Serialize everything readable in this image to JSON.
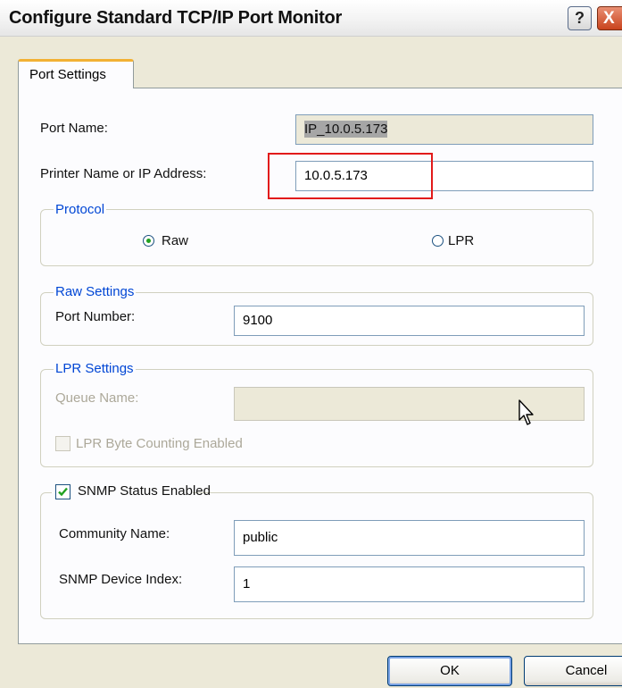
{
  "window": {
    "title": "Configure Standard TCP/IP Port Monitor",
    "help_glyph": "?",
    "close_glyph": "X"
  },
  "tabs": [
    {
      "label": "Port Settings",
      "active": true
    }
  ],
  "port_name": {
    "label": "Port Name:",
    "value": "IP_10.0.5.173"
  },
  "printer_address": {
    "label": "Printer Name or IP Address:",
    "value": "10.0.5.173",
    "highlight_color": "#e21a1a"
  },
  "protocol": {
    "legend": "Protocol",
    "options": [
      {
        "label": "Raw",
        "selected": true
      },
      {
        "label": "LPR",
        "selected": false
      }
    ]
  },
  "raw_settings": {
    "legend": "Raw Settings",
    "port_number_label": "Port Number:",
    "port_number_value": "9100"
  },
  "lpr_settings": {
    "legend": "LPR Settings",
    "queue_name_label": "Queue Name:",
    "queue_name_value": "",
    "byte_counting_label": "LPR Byte Counting Enabled",
    "byte_counting_checked": false,
    "enabled": false
  },
  "snmp": {
    "label": "SNMP Status Enabled",
    "checked": true,
    "community_label": "Community Name:",
    "community_value": "public",
    "device_index_label": "SNMP Device Index:",
    "device_index_value": "1"
  },
  "buttons": {
    "ok": "OK",
    "cancel": "Cancel"
  },
  "colors": {
    "dialog_bg": "#ece9d8",
    "accent_blue": "#0046d5",
    "tab_highlight": "#f2b134"
  }
}
